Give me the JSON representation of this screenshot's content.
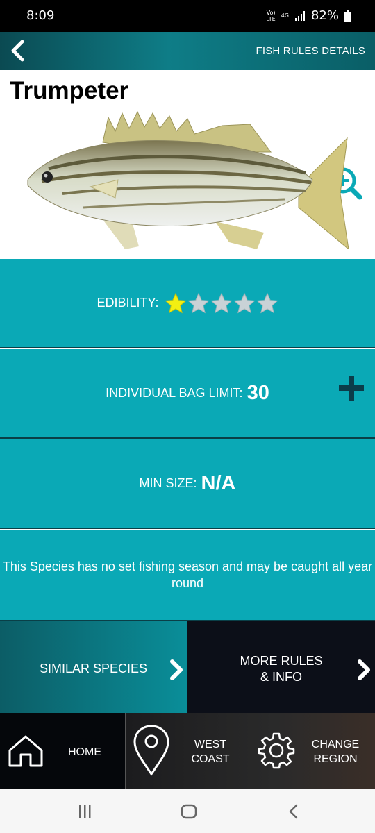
{
  "status_bar": {
    "time": "8:09",
    "volte_top": "Vo)",
    "volte_bottom": "LTE",
    "network": "4G",
    "battery": "82%"
  },
  "header": {
    "title": "FISH RULES DETAILS"
  },
  "species": {
    "name": "Trumpeter"
  },
  "edibility": {
    "label": "EDIBILITY:",
    "rating": 1,
    "max": 5,
    "filled_color": "#f3ef12",
    "empty_color": "#c9d2d6"
  },
  "bag_limit": {
    "label": "INDIVIDUAL BAG LIMIT:",
    "value": "30"
  },
  "min_size": {
    "label": "MIN SIZE:",
    "value": "N/A"
  },
  "season": {
    "text": "This Species has no set fishing season and may be caught all year round"
  },
  "actions": {
    "similar": "SIMILAR SPECIES",
    "more_rules_line1": "MORE RULES",
    "more_rules_line2": "& INFO"
  },
  "bottom_nav": {
    "home": "HOME",
    "region_line1": "WEST",
    "region_line2": "COAST",
    "change_line1": "CHANGE",
    "change_line2": "REGION"
  },
  "colors": {
    "accent": "#0aa9b6",
    "header": "#0e7d87",
    "plus": "#0b3d4a"
  }
}
